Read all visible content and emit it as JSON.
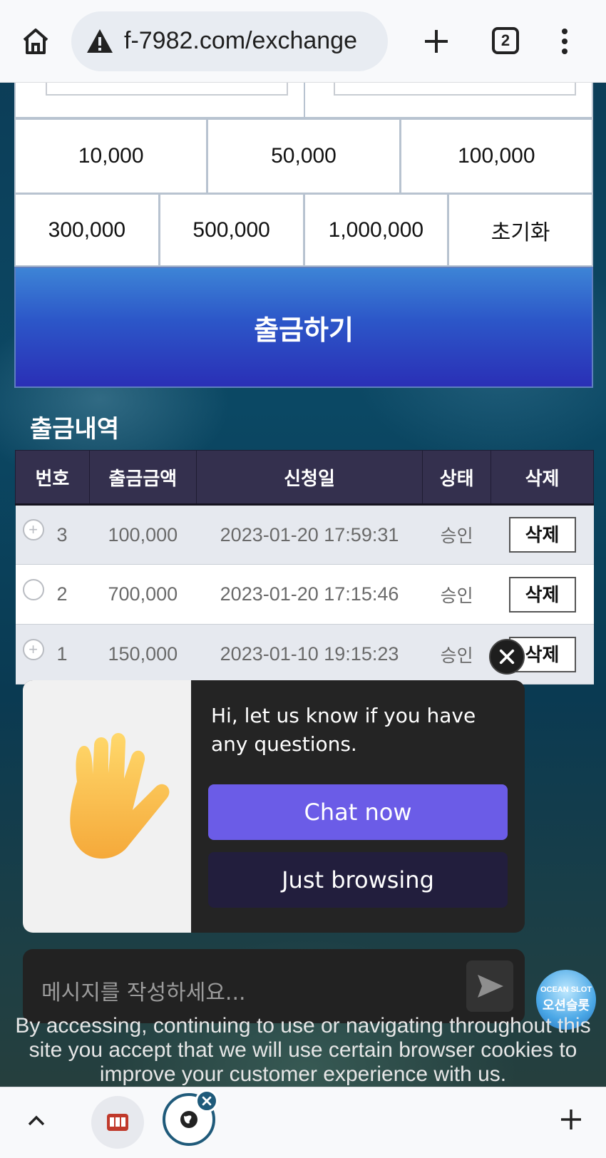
{
  "browser": {
    "url": "f-7982.com/exchange",
    "tab_count": "2"
  },
  "amount_buttons": {
    "row1": [
      "10,000",
      "50,000",
      "100,000"
    ],
    "row2": [
      "300,000",
      "500,000",
      "1,000,000",
      "초기화"
    ]
  },
  "withdraw_button": "출금하기",
  "history": {
    "title": "출금내역",
    "columns": [
      "번호",
      "출금금액",
      "신청일",
      "상태",
      "삭제"
    ],
    "rows": [
      {
        "no": "3",
        "amount": "100,000",
        "date": "2023-01-20 17:59:31",
        "status": "승인",
        "delete": "삭제"
      },
      {
        "no": "2",
        "amount": "700,000",
        "date": "2023-01-20 17:15:46",
        "status": "승인",
        "delete": "삭제"
      },
      {
        "no": "1",
        "amount": "150,000",
        "date": "2023-01-10 19:15:23",
        "status": "승인",
        "delete": "삭제"
      }
    ]
  },
  "chat": {
    "message": "Hi, let us know if you have any questions.",
    "chat_now": "Chat now",
    "just_browsing": "Just browsing",
    "input_placeholder": "메시지를 작성하세요...",
    "accent_color": "#6b5ce7"
  },
  "logo": {
    "line1": "OCEAN SLOT",
    "line2": "오션슬롯"
  },
  "cookie_notice": "By accessing, continuing to use or navigating throughout this site you accept that we will use certain browser cookies to improve your customer experience with us."
}
